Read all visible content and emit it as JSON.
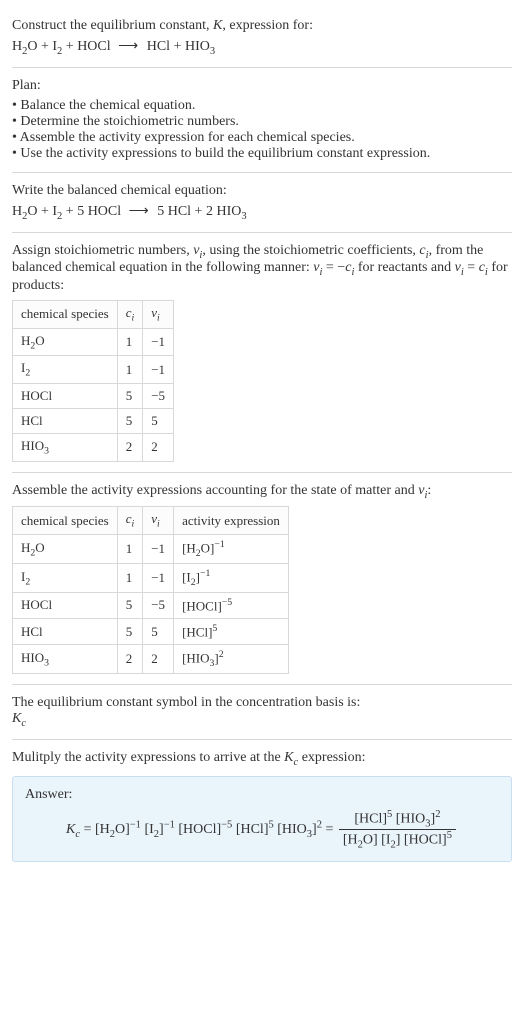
{
  "s1": {
    "title": "Construct the equilibrium constant, <span class='ital'>K</span>, expression for:",
    "eqn": "H<sub>2</sub>O + I<sub>2</sub> + HOCl <span class='arrow'>⟶</span> HCl + HIO<sub>3</sub>"
  },
  "s2": {
    "title": "Plan:",
    "items": [
      "Balance the chemical equation.",
      "Determine the stoichiometric numbers.",
      "Assemble the activity expression for each chemical species.",
      "Use the activity expressions to build the equilibrium constant expression."
    ]
  },
  "s3": {
    "title": "Write the balanced chemical equation:",
    "eqn": "H<sub>2</sub>O + I<sub>2</sub> + 5 HOCl <span class='arrow'>⟶</span> 5 HCl + 2 HIO<sub>3</sub>"
  },
  "s4": {
    "text": "Assign stoichiometric numbers, <span class='ital'>ν<sub>i</sub></span>, using the stoichiometric coefficients, <span class='ital'>c<sub>i</sub></span>, from the balanced chemical equation in the following manner: <span class='ital'>ν<sub>i</sub></span> = −<span class='ital'>c<sub>i</sub></span> for reactants and <span class='ital'>ν<sub>i</sub></span> = <span class='ital'>c<sub>i</sub></span> for products:",
    "headers": [
      "chemical species",
      "<span class='ital'>c<sub>i</sub></span>",
      "<span class='ital'>ν<sub>i</sub></span>"
    ],
    "rows": [
      [
        "H<sub>2</sub>O",
        "1",
        "−1"
      ],
      [
        "I<sub>2</sub>",
        "1",
        "−1"
      ],
      [
        "HOCl",
        "5",
        "−5"
      ],
      [
        "HCl",
        "5",
        "5"
      ],
      [
        "HIO<sub>3</sub>",
        "2",
        "2"
      ]
    ]
  },
  "s5": {
    "text": "Assemble the activity expressions accounting for the state of matter and <span class='ital'>ν<sub>i</sub></span>:",
    "headers": [
      "chemical species",
      "<span class='ital'>c<sub>i</sub></span>",
      "<span class='ital'>ν<sub>i</sub></span>",
      "activity expression"
    ],
    "rows": [
      [
        "H<sub>2</sub>O",
        "1",
        "−1",
        "[H<sub>2</sub>O]<sup>−1</sup>"
      ],
      [
        "I<sub>2</sub>",
        "1",
        "−1",
        "[I<sub>2</sub>]<sup>−1</sup>"
      ],
      [
        "HOCl",
        "5",
        "−5",
        "[HOCl]<sup>−5</sup>"
      ],
      [
        "HCl",
        "5",
        "5",
        "[HCl]<sup>5</sup>"
      ],
      [
        "HIO<sub>3</sub>",
        "2",
        "2",
        "[HIO<sub>3</sub>]<sup>2</sup>"
      ]
    ]
  },
  "s6": {
    "line1": "The equilibrium constant symbol in the concentration basis is:",
    "line2": "<span class='ital'>K<sub>c</sub></span>"
  },
  "s7": {
    "text": "Mulitply the activity expressions to arrive at the <span class='ital'>K<sub>c</sub></span> expression:",
    "answer_label": "Answer:",
    "kc_lhs": "<span class='ital'>K<sub>c</sub></span> = [H<sub>2</sub>O]<sup>−1</sup> [I<sub>2</sub>]<sup>−1</sup> [HOCl]<sup>−5</sup> [HCl]<sup>5</sup> [HIO<sub>3</sub>]<sup>2</sup> = ",
    "frac_num": "[HCl]<sup>5</sup> [HIO<sub>3</sub>]<sup>2</sup>",
    "frac_den": "[H<sub>2</sub>O] [I<sub>2</sub>] [HOCl]<sup>5</sup>"
  }
}
